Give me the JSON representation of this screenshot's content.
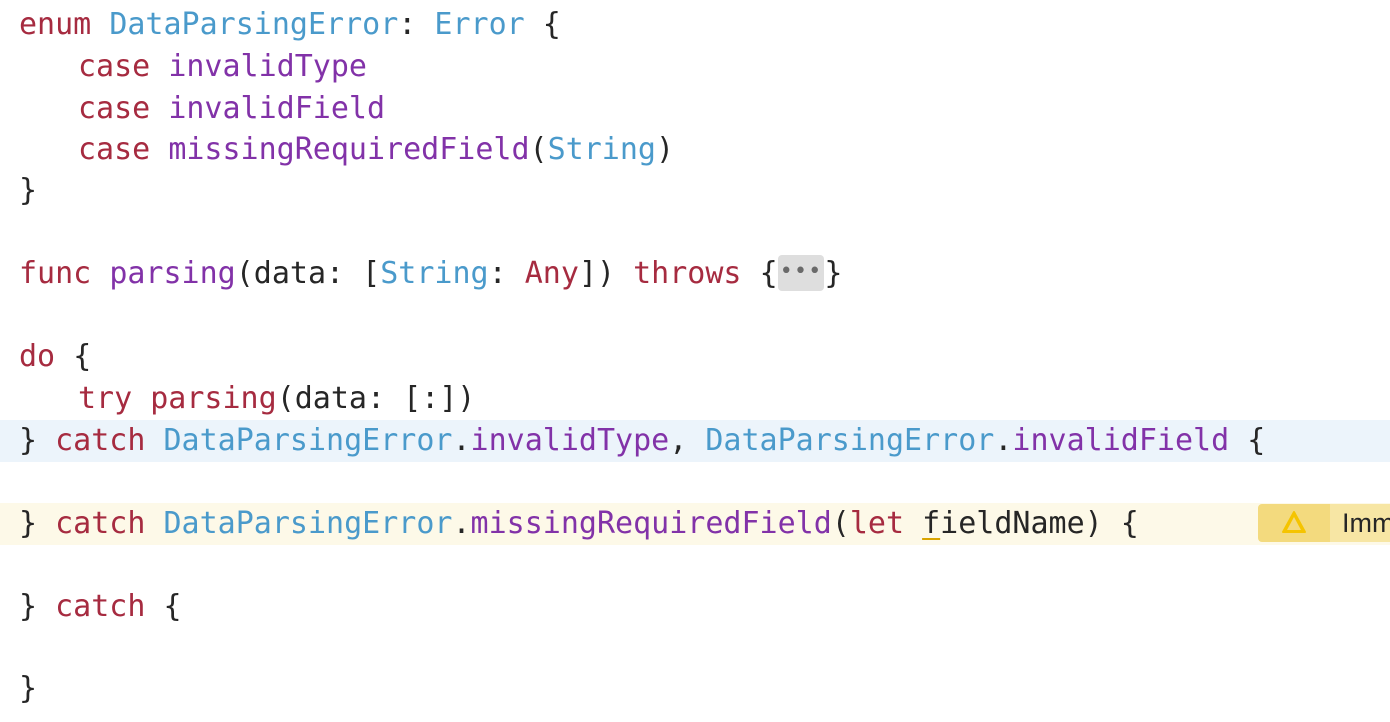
{
  "editor": {
    "lines": {
      "enum_decl": {
        "kw_enum": "enum",
        "type_name": "DataParsingError",
        "colon": ":",
        "protocol": "Error",
        "brace": "{"
      },
      "case1": {
        "kw_case": "case",
        "name": "invalidType"
      },
      "case2": {
        "kw_case": "case",
        "name": "invalidField"
      },
      "case3": {
        "kw_case": "case",
        "name": "missingRequiredField",
        "open": "(",
        "type": "String",
        "close": ")"
      },
      "enum_close": {
        "brace": "}"
      },
      "func_decl": {
        "kw_func": "func",
        "name": "parsing",
        "params_open": "(data: [",
        "key_type": "String",
        "sep": ": ",
        "value_type": "Any",
        "params_close": "])",
        "kw_throws": "throws",
        "brace_open": "{",
        "fold": "•••",
        "brace_close": "}"
      },
      "do_stmt": {
        "kw_do": "do",
        "brace": "{"
      },
      "try_stmt": {
        "kw_try": "try",
        "call": "parsing",
        "args": "(data: [:])"
      },
      "catch1": {
        "brace": "}",
        "kw_catch": "catch",
        "type_a": "DataParsingError",
        "dot_a": ".",
        "case_a": "invalidType",
        "comma": ",",
        "type_b": "DataParsingError",
        "dot_b": ".",
        "case_b": "invalidField",
        "open": "{"
      },
      "catch2": {
        "brace": "}",
        "kw_catch": "catch",
        "type": "DataParsingError",
        "dot": ".",
        "case": "missingRequiredField",
        "open_paren": "(",
        "kw_let": "let",
        "binding_first": "f",
        "binding_rest": "ieldName",
        "close": ") {"
      },
      "catch3": {
        "brace": "}",
        "kw_catch": "catch",
        "open": "{"
      },
      "final_close": {
        "brace": "}"
      }
    },
    "warning": {
      "icon": "warning-triangle-icon",
      "text": "Imm"
    },
    "colors": {
      "keyword": "#a62b40",
      "type": "#4a9acb",
      "function": "#8232a8",
      "plain": "#262626",
      "current_line": "#ecf4fb",
      "warning_line": "#fdf9e8",
      "warning_pill": "#f7e6a4"
    }
  }
}
